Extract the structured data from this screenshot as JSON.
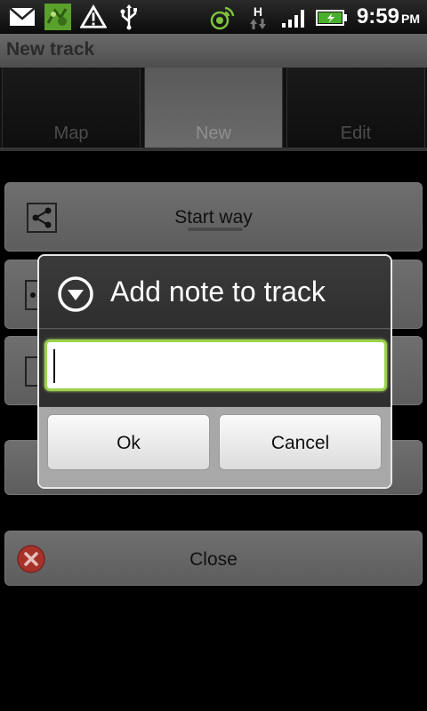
{
  "status_bar": {
    "icons_left": [
      "mail-icon",
      "app-logo-icon",
      "warning-icon",
      "usb-icon"
    ],
    "icons_right": [
      "gps-icon",
      "network-h-icon",
      "signal-icon",
      "battery-icon"
    ],
    "network_label": "H",
    "time": "9:59",
    "ampm": "PM"
  },
  "app": {
    "title": "New track"
  },
  "tabs": [
    {
      "label": "Map",
      "selected": false
    },
    {
      "label": "New",
      "selected": true
    },
    {
      "label": "Edit",
      "selected": false
    }
  ],
  "actions": {
    "start_way": "Start way",
    "close": "Close"
  },
  "dialog": {
    "title": "Add note to track",
    "input_value": "",
    "ok": "Ok",
    "cancel": "Cancel"
  },
  "colors": {
    "input_focus": "#9bd24a",
    "close_icon": "#d9382b"
  }
}
